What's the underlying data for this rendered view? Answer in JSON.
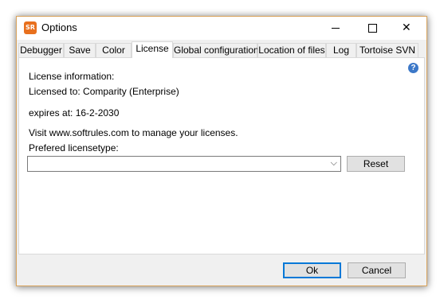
{
  "window": {
    "title": "Options",
    "icon_text": "SR"
  },
  "tabs": [
    {
      "label": "Debugger",
      "active": false
    },
    {
      "label": "Save",
      "active": false
    },
    {
      "label": "Color",
      "active": false
    },
    {
      "label": "License",
      "active": true
    },
    {
      "label": "Global configuration",
      "active": false
    },
    {
      "label": "Location of files",
      "active": false
    },
    {
      "label": "Log",
      "active": false
    },
    {
      "label": "Tortoise SVN",
      "active": false
    }
  ],
  "license": {
    "heading": "License information:",
    "licensed_to": "Licensed to: Comparity (Enterprise)",
    "expires": "expires at: 16-2-2030",
    "visit_text": "Visit www.softrules.com to manage your licenses.",
    "type_label": "Prefered licensetype:",
    "type_value": "",
    "reset_label": "Reset"
  },
  "footer": {
    "ok_label": "Ok",
    "cancel_label": "Cancel"
  },
  "icons": {
    "help": "?",
    "close": "✕",
    "chevron": "⌵"
  },
  "colors": {
    "accent": "#0078d7",
    "window_border": "#d9a35b",
    "app_icon": "#e8701e",
    "help_icon": "#3c78c8"
  }
}
